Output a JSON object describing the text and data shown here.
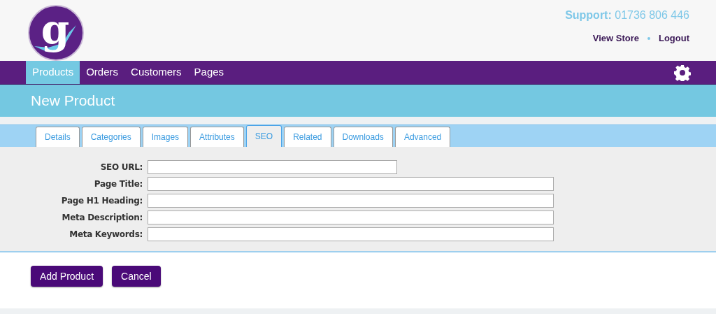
{
  "logo": {
    "letter": "g"
  },
  "support": {
    "label": "Support:",
    "phone": "01736 806 446"
  },
  "header_links": [
    "View Store",
    "Logout"
  ],
  "nav": [
    {
      "label": "Products",
      "selected": true
    },
    {
      "label": "Orders",
      "selected": false
    },
    {
      "label": "Customers",
      "selected": false
    },
    {
      "label": "Pages",
      "selected": false
    }
  ],
  "page_title": "New Product",
  "tabs": [
    {
      "label": "Details",
      "selected": false
    },
    {
      "label": "Categories",
      "selected": false
    },
    {
      "label": "Images",
      "selected": false
    },
    {
      "label": "Attributes",
      "selected": false
    },
    {
      "label": "SEO",
      "selected": true
    },
    {
      "label": "Related",
      "selected": false
    },
    {
      "label": "Downloads",
      "selected": false
    },
    {
      "label": "Advanced",
      "selected": false
    }
  ],
  "fields": [
    {
      "label": "SEO URL:",
      "kind": "short"
    },
    {
      "label": "Page Title:",
      "kind": "long"
    },
    {
      "label": "Page H1 Heading:",
      "kind": "long"
    },
    {
      "label": "Meta Description:",
      "kind": "long"
    },
    {
      "label": "Meta Keywords:",
      "kind": "long"
    }
  ],
  "buttons": [
    "Add Product",
    "Cancel"
  ]
}
